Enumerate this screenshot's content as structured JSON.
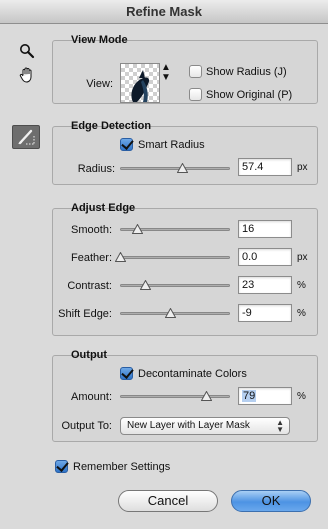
{
  "window": {
    "title": "Refine Mask"
  },
  "tools": {
    "zoom": "magnifier-icon",
    "hand": "hand-icon",
    "refine_brush": "refine-radius-brush-icon"
  },
  "view_mode": {
    "title": "View Mode",
    "view_label": "View:",
    "show_radius": {
      "label": "Show Radius (J)",
      "checked": false
    },
    "show_original": {
      "label": "Show Original (P)",
      "checked": false
    }
  },
  "edge_detection": {
    "title": "Edge Detection",
    "smart_radius": {
      "label": "Smart Radius",
      "checked": true
    },
    "radius": {
      "label": "Radius:",
      "value": "57.4",
      "unit": "px",
      "slider_fraction": 0.57
    }
  },
  "adjust_edge": {
    "title": "Adjust Edge",
    "smooth": {
      "label": "Smooth:",
      "value": "16",
      "unit": "",
      "slider_fraction": 0.16
    },
    "feather": {
      "label": "Feather:",
      "value": "0.0",
      "unit": "px",
      "slider_fraction": 0.0
    },
    "contrast": {
      "label": "Contrast:",
      "value": "23",
      "unit": "%",
      "slider_fraction": 0.23
    },
    "shift_edge": {
      "label": "Shift Edge:",
      "value": "-9",
      "unit": "%",
      "slider_fraction": 0.455
    }
  },
  "output": {
    "title": "Output",
    "decontaminate": {
      "label": "Decontaminate Colors",
      "checked": true
    },
    "amount": {
      "label": "Amount:",
      "value": "79",
      "unit": "%",
      "slider_fraction": 0.79
    },
    "output_to": {
      "label": "Output To:",
      "selected": "New Layer with Layer Mask"
    }
  },
  "remember": {
    "label": "Remember Settings",
    "checked": true
  },
  "buttons": {
    "cancel": "Cancel",
    "ok": "OK"
  },
  "colors": {
    "accent_blue": "#4d93e3",
    "window_bg": "#dadada"
  }
}
